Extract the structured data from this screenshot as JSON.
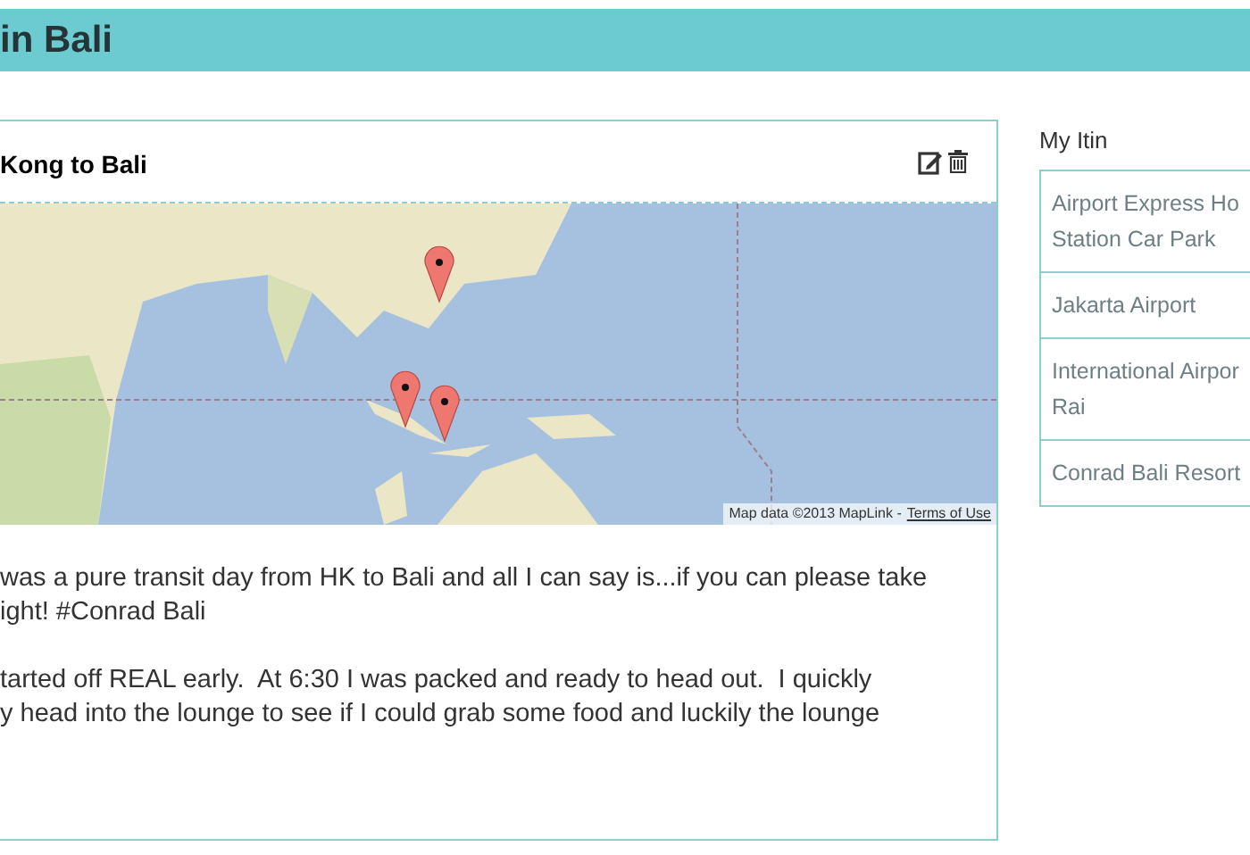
{
  "header": {
    "title": "in Bali"
  },
  "post": {
    "title": "Kong to Bali",
    "map": {
      "attribution": "Map data ©2013 MapLink -",
      "terms": "Terms of Use"
    },
    "paragraphs": [
      "was a pure transit day from HK to Bali and all I can say is...if you can please take\night! #Conrad Bali",
      "tarted off REAL early.  At 6:30 I was packed and ready to head out.  I quickly\ny head into the lounge to see if I could grab some food and luckily the lounge"
    ]
  },
  "sidebar": {
    "title": "My Itin",
    "items": [
      "Airport Express Ho\nStation Car Park",
      "Jakarta Airport",
      "International Airpor\nRai",
      "Conrad Bali Resort"
    ]
  }
}
